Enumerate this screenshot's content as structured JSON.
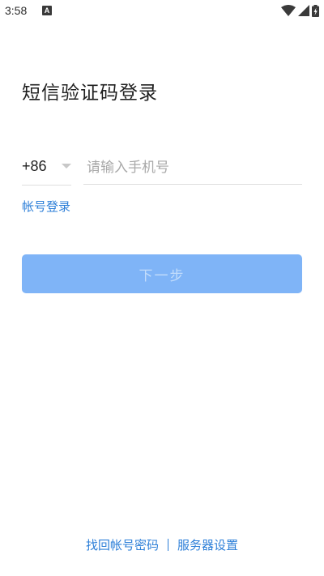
{
  "status_bar": {
    "time": "3:58",
    "notification_icon_letter": "A",
    "icons": [
      "wifi-icon",
      "signal-icon",
      "battery-charging-icon"
    ]
  },
  "login": {
    "title": "短信验证码登录",
    "country_code": "+86",
    "phone_placeholder": "请输入手机号",
    "phone_value": "",
    "account_login_label": "帐号登录",
    "next_button_label": "下一步",
    "next_button_enabled": false
  },
  "footer": {
    "recover_password_label": "找回帐号密码",
    "server_settings_label": "服务器设置"
  },
  "colors": {
    "link": "#2d7fd8",
    "button_disabled_bg": "#7fb4f7",
    "button_disabled_text": "#c3ddfb"
  }
}
